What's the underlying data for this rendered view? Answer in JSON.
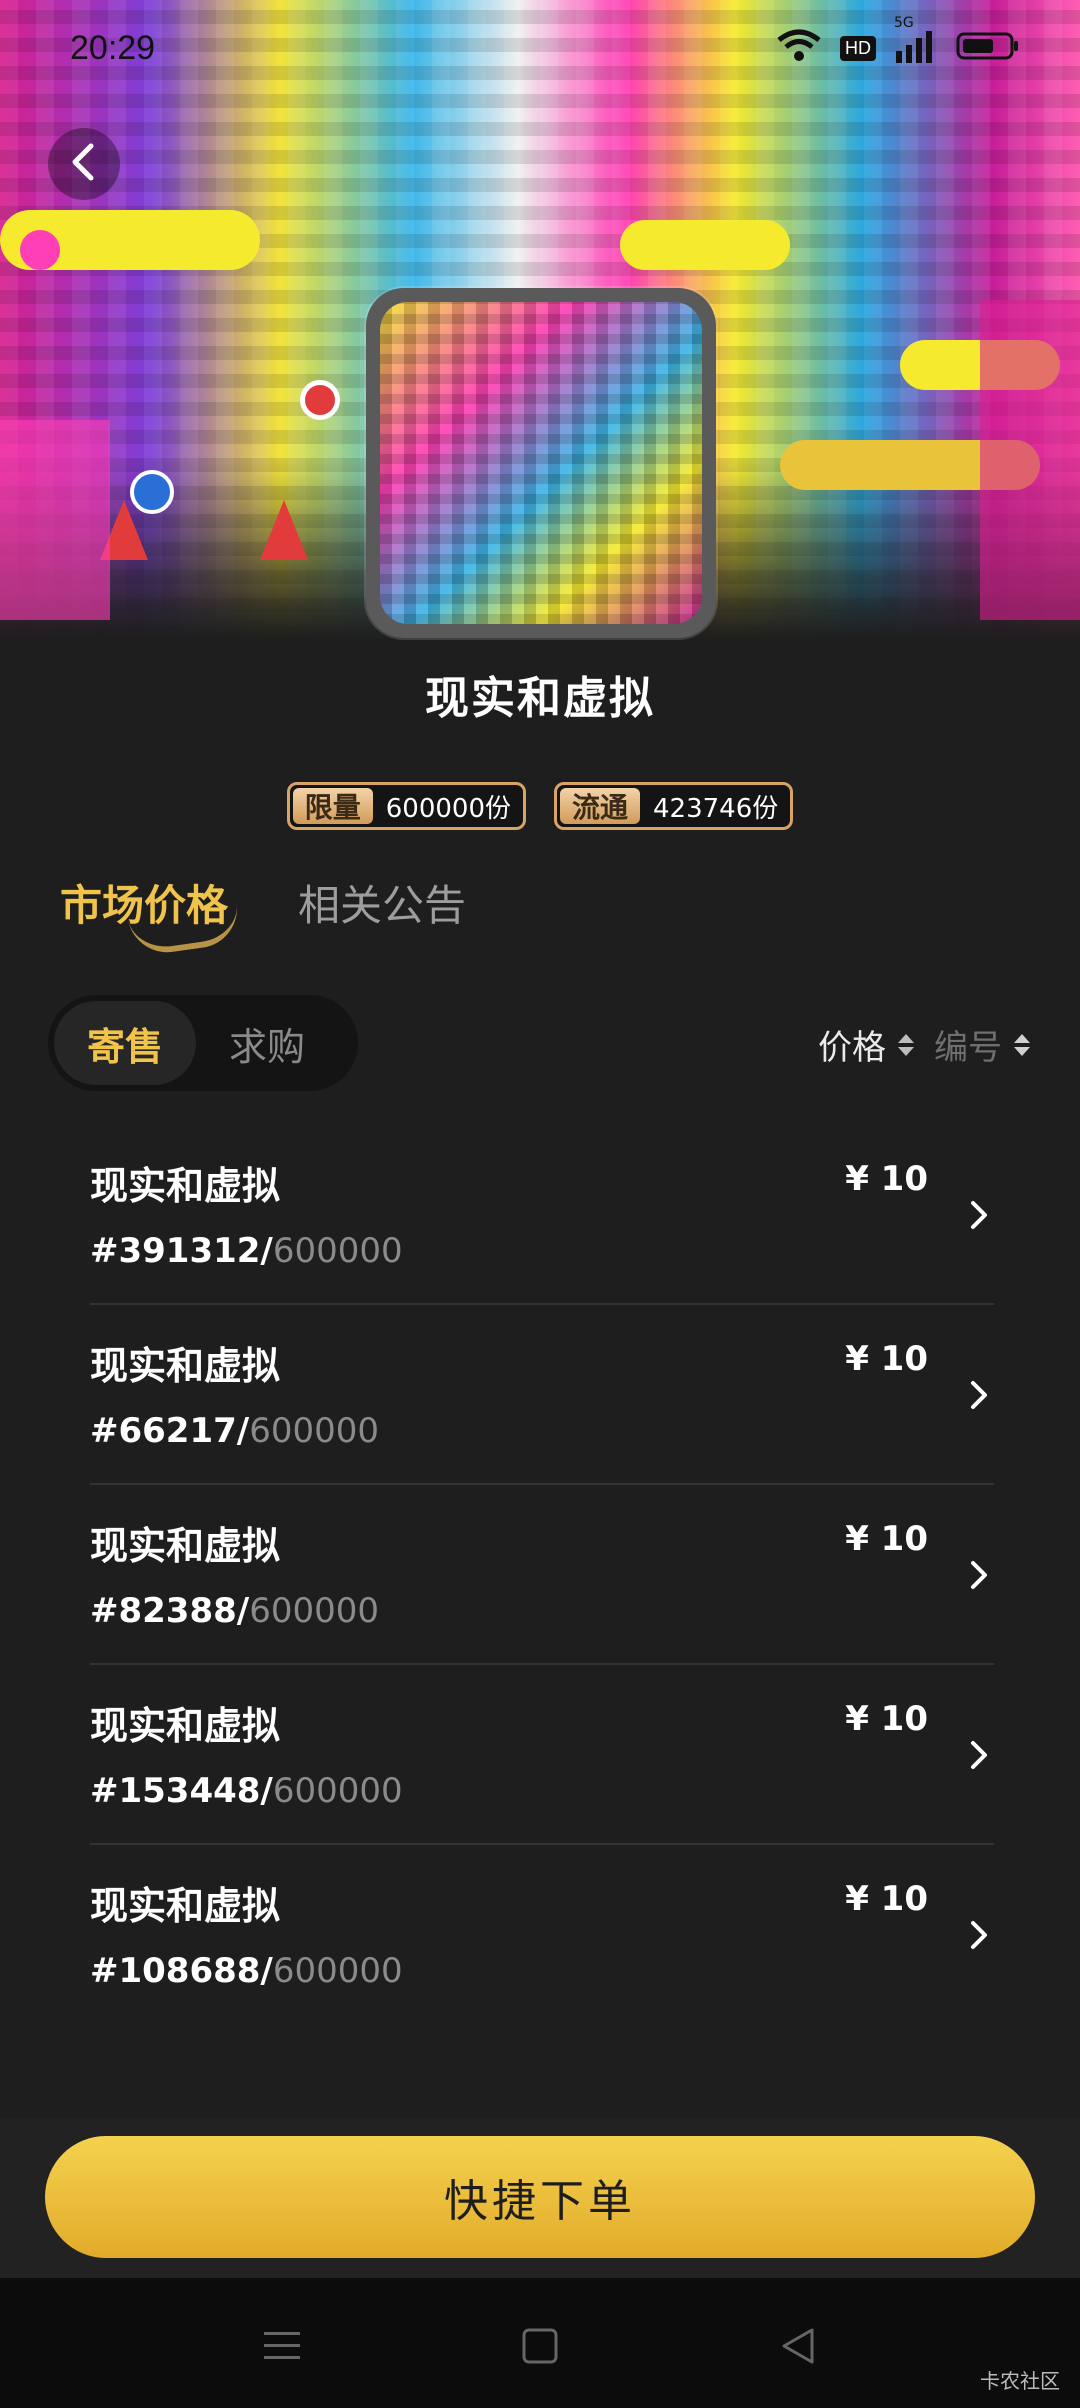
{
  "status_bar": {
    "time": "20:29",
    "wifi_icon": "wifi-icon",
    "hd_label": "HD",
    "network_label": "5G",
    "battery_icon": "battery-icon"
  },
  "header": {
    "back_icon": "chevron-left-icon",
    "title": "现实和虚拟"
  },
  "badges": [
    {
      "label": "限量",
      "value": "600000份"
    },
    {
      "label": "流通",
      "value": "423746份"
    }
  ],
  "tabs": [
    {
      "label": "市场价格",
      "active": true
    },
    {
      "label": "相关公告",
      "active": false
    }
  ],
  "segment": [
    {
      "label": "寄售",
      "active": true
    },
    {
      "label": "求购",
      "active": false
    }
  ],
  "sort": [
    {
      "label": "价格",
      "active": true
    },
    {
      "label": "编号",
      "active": false
    }
  ],
  "listings": [
    {
      "name": "现实和虚拟",
      "serial": "#391312/",
      "total": "600000",
      "price": "¥ 10"
    },
    {
      "name": "现实和虚拟",
      "serial": "#66217/",
      "total": "600000",
      "price": "¥ 10"
    },
    {
      "name": "现实和虚拟",
      "serial": "#82388/",
      "total": "600000",
      "price": "¥ 10"
    },
    {
      "name": "现实和虚拟",
      "serial": "#153448/",
      "total": "600000",
      "price": "¥ 10"
    },
    {
      "name": "现实和虚拟",
      "serial": "#108688/",
      "total": "600000",
      "price": "¥ 10"
    }
  ],
  "order_button": "快捷下单",
  "watermark": "卡农社区",
  "colors": {
    "accent": "#f0c34a",
    "background": "#1e1e1e",
    "button": "#e8ba36"
  }
}
